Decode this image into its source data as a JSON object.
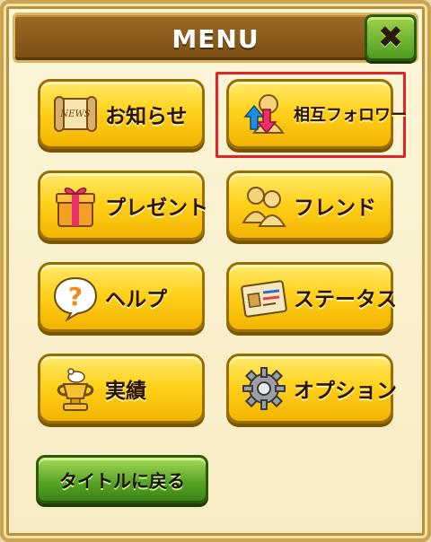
{
  "header": {
    "title": "MENU",
    "close_glyph": "✖"
  },
  "menu": {
    "news": {
      "label": "お知らせ",
      "icon": "news-scroll-icon",
      "badge": "NEWS"
    },
    "mutual": {
      "label": "相互フォロワー",
      "icon": "mutual-follower-icon"
    },
    "present": {
      "label": "プレゼント",
      "icon": "gift-box-icon"
    },
    "friend": {
      "label": "フレンド",
      "icon": "friends-icon"
    },
    "help": {
      "label": "ヘルプ",
      "icon": "help-bubble-icon",
      "glyph": "?"
    },
    "status": {
      "label": "ステータス",
      "icon": "status-card-icon"
    },
    "achievement": {
      "label": "実績",
      "icon": "trophy-icon"
    },
    "option": {
      "label": "オプション",
      "icon": "gear-icon"
    }
  },
  "footer": {
    "back_to_title_label": "タイトルに戻る"
  },
  "colors": {
    "highlight": "#e0242c",
    "button_yellow": "#ffd21c",
    "button_green": "#5aa628"
  }
}
